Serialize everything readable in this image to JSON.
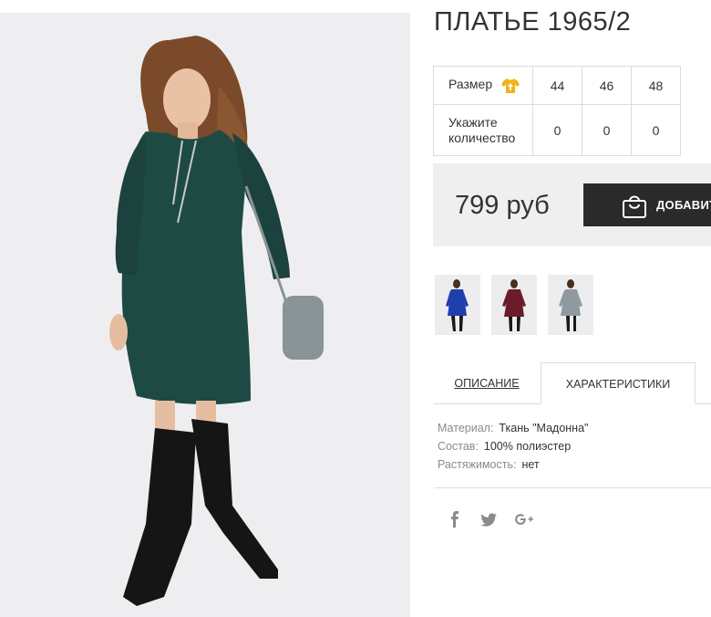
{
  "product": {
    "title": "ПЛАТЬЕ 1965/2",
    "price": "799 руб",
    "buy_label": "ДОБАВИТЬ"
  },
  "size_table": {
    "size_label": "Размер",
    "size_icon": "tshirt-icon",
    "sizes": [
      "44",
      "46",
      "48"
    ],
    "qty_label": "Укажите количество",
    "quantities": [
      "0",
      "0",
      "0"
    ]
  },
  "colors": {
    "main_dress": "#1e4a44",
    "thumb_colors": [
      "#1f3fae",
      "#6b1b2a",
      "#8f9aa0"
    ],
    "button_bg": "#2a2a2a",
    "icon_accent": "#f2b21b"
  },
  "tabs": [
    {
      "label": "ОПИСАНИЕ"
    },
    {
      "label": "ХАРАКТЕРИСТИКИ"
    }
  ],
  "specs": [
    {
      "key": "Материал:",
      "value": "Ткань \"Мадонна\""
    },
    {
      "key": "Состав:",
      "value": "100% полиэстер"
    },
    {
      "key": "Растяжимость:",
      "value": "нет"
    }
  ],
  "social": [
    "facebook-icon",
    "twitter-icon",
    "google-plus-icon"
  ]
}
